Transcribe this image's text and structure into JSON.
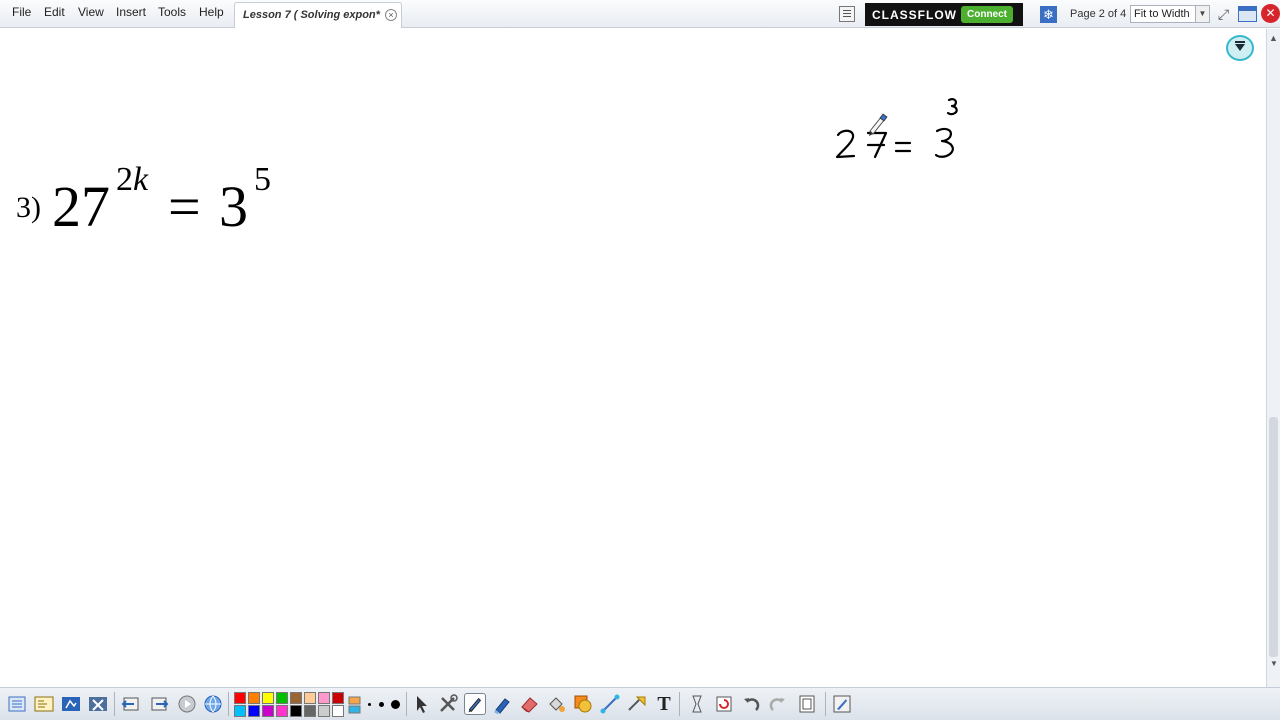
{
  "menu": {
    "file": "File",
    "edit": "Edit",
    "view": "View",
    "insert": "Insert",
    "tools": "Tools",
    "help": "Help"
  },
  "tab": {
    "title": "Lesson 7 ( Solving expon*",
    "close": "×"
  },
  "classflow": {
    "label": "CLASSFLOW",
    "connect": "Connect"
  },
  "page_indicator": "Page 2 of 4",
  "zoom": "Fit to Width",
  "problem": {
    "number": "3)",
    "base": "27",
    "base_exponent_num": "2",
    "base_exponent_var": "k",
    "equals": "=",
    "rhs": "3",
    "rhs_exponent": "5"
  },
  "handwriting": "27 = 3³",
  "palette": {
    "row1": [
      "#ff0000",
      "#ff8000",
      "#ffff00",
      "#00c000",
      "#996633",
      "#ffcc99",
      "#ff99cc",
      "#cc0000"
    ],
    "row2": [
      "#00c0ff",
      "#0000ff",
      "#cc00cc",
      "#ff33cc",
      "#000000",
      "#666666",
      "#cccccc",
      "#ffffff"
    ]
  }
}
